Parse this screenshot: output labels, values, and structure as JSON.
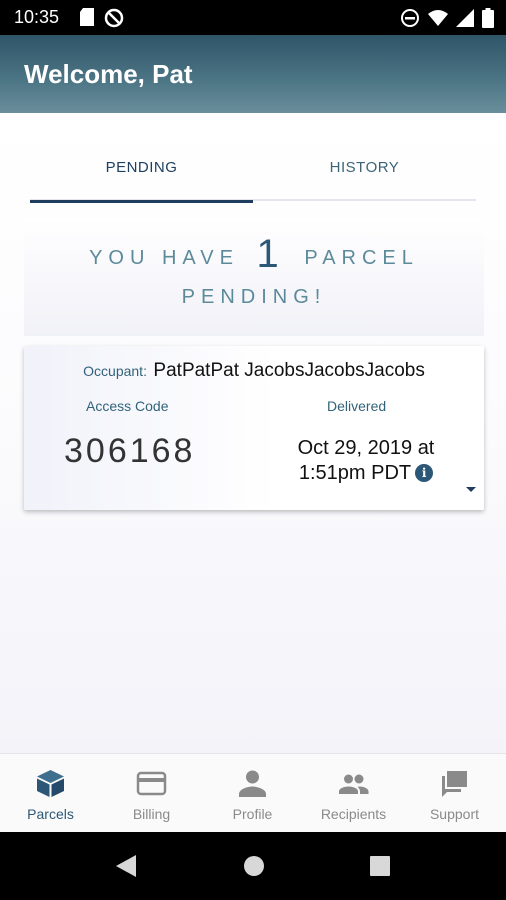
{
  "status_bar": {
    "time": "10:35",
    "left_icons": [
      "sd-card-icon",
      "do-not-disturb-icon"
    ],
    "right_icons": [
      "minus-circle-icon",
      "wifi-icon",
      "signal-icon",
      "battery-icon"
    ]
  },
  "app_bar": {
    "title": "Welcome, Pat"
  },
  "tabs": [
    {
      "label": "PENDING",
      "active": true
    },
    {
      "label": "HISTORY",
      "active": false
    }
  ],
  "pending_banner": {
    "prefix": "YOU HAVE",
    "count": "1",
    "suffix": "PARCEL",
    "line2": "PENDING!"
  },
  "parcel": {
    "occupant_label": "Occupant:",
    "occupant_name": "PatPatPat JacobsJacobsJacobs",
    "access_code_label": "Access Code",
    "access_code": "306168",
    "delivered_label": "Delivered",
    "delivered_line1": "Oct 29, 2019 at",
    "delivered_line2": "1:51pm PDT",
    "info_symbol": "i"
  },
  "bottom_nav": [
    {
      "label": "Parcels",
      "icon": "box-icon",
      "active": true
    },
    {
      "label": "Billing",
      "icon": "credit-card-icon",
      "active": false
    },
    {
      "label": "Profile",
      "icon": "person-icon",
      "active": false
    },
    {
      "label": "Recipients",
      "icon": "people-icon",
      "active": false
    },
    {
      "label": "Support",
      "icon": "chat-icon",
      "active": false
    }
  ],
  "colors": {
    "accent": "#2d5776",
    "app_bar_top": "#2f5568",
    "app_bar_bottom": "#6a8f9b",
    "nav_inactive": "#8a8a8a"
  }
}
